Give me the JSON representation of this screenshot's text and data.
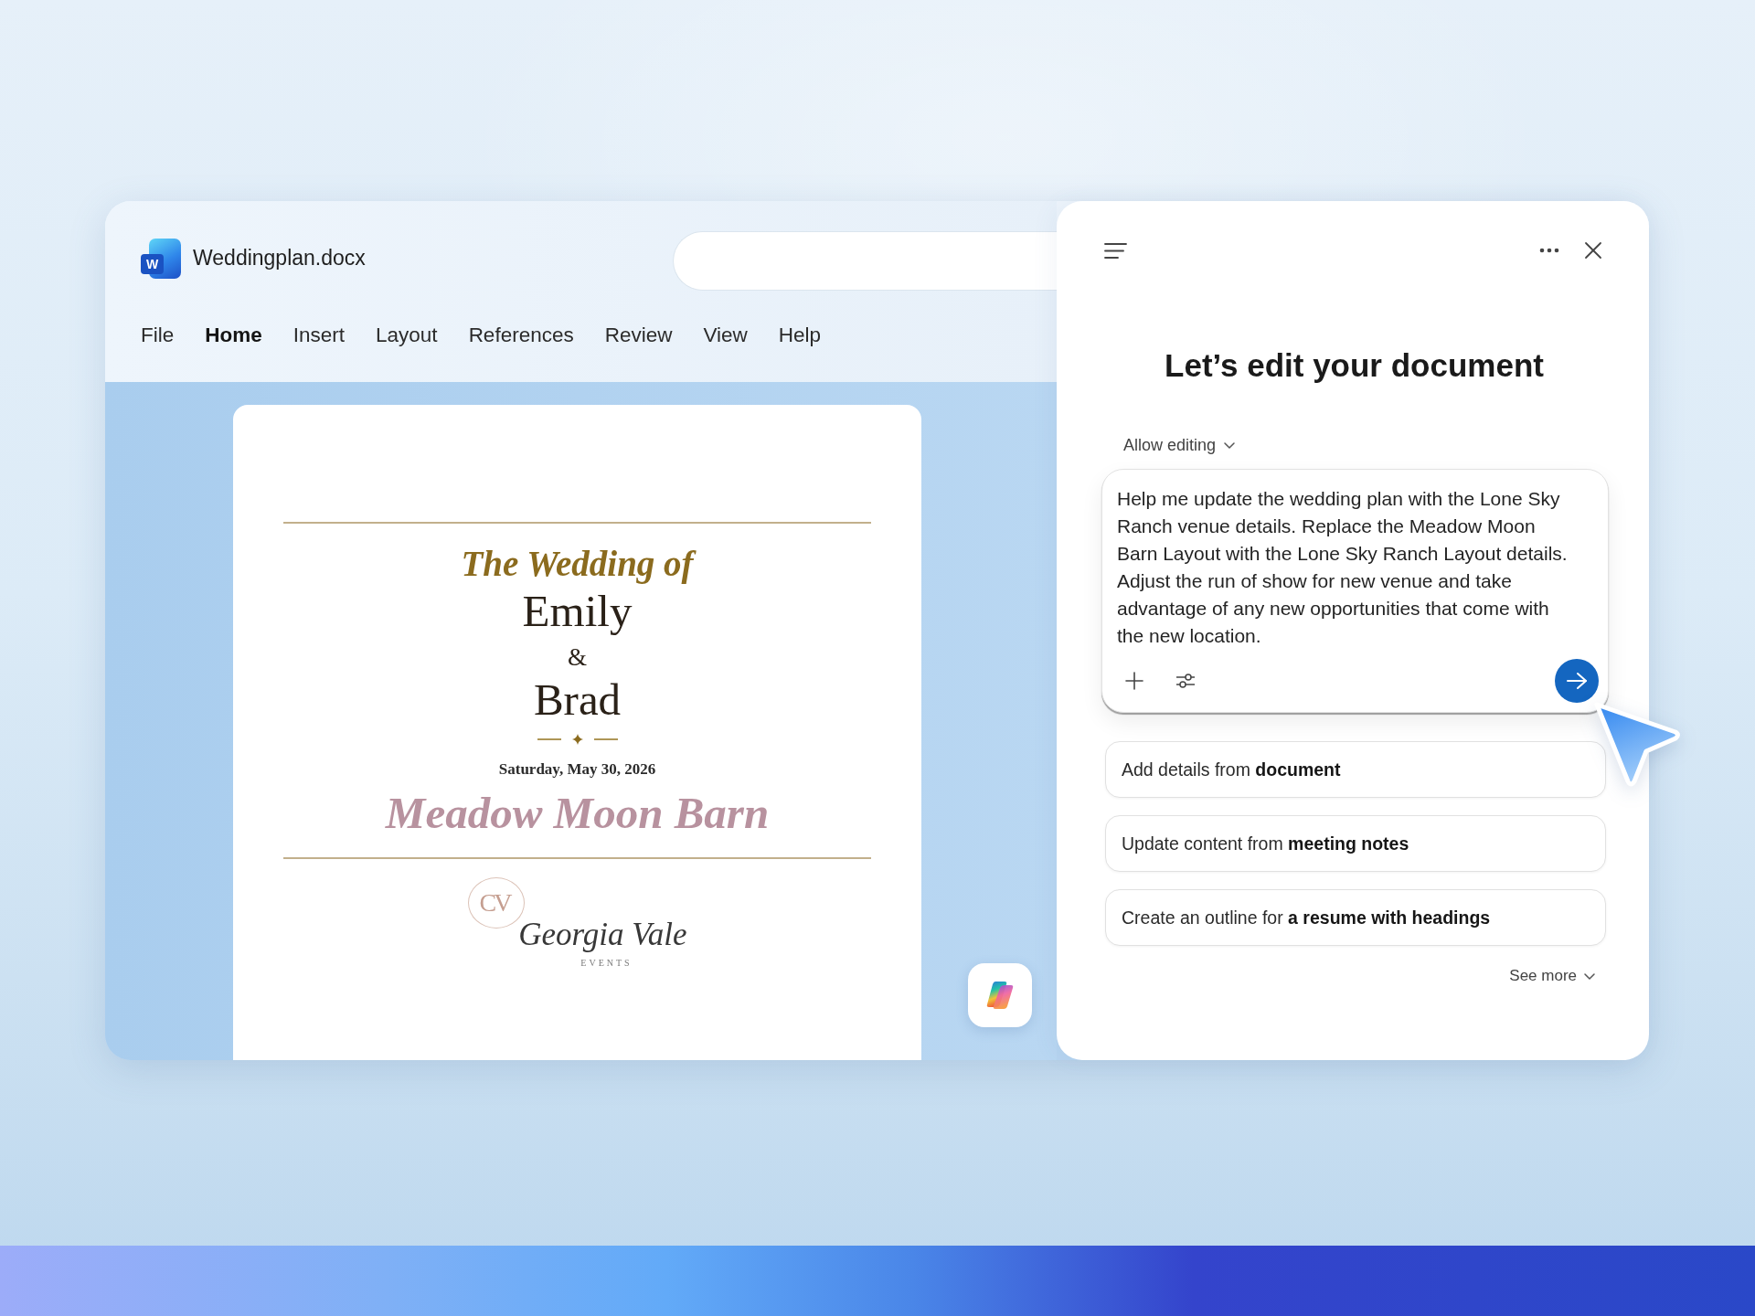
{
  "document_window": {
    "app_icon_letter": "W",
    "file_name": "Weddingplan.docx",
    "ribbon_tabs": [
      {
        "label": "File",
        "selected": false
      },
      {
        "label": "Home",
        "selected": true
      },
      {
        "label": "Insert",
        "selected": false
      },
      {
        "label": "Layout",
        "selected": false
      },
      {
        "label": "References",
        "selected": false
      },
      {
        "label": "Review",
        "selected": false
      },
      {
        "label": "View",
        "selected": false
      },
      {
        "label": "Help",
        "selected": false
      }
    ]
  },
  "document_page": {
    "heading": "The Wedding of",
    "partner_1": "Emily",
    "ampersand": "&",
    "partner_2": "Brad",
    "date": "Saturday, May 30, 2026",
    "venue": "Meadow Moon Barn",
    "logo": {
      "monogram": "CV",
      "name": "Georgia Vale",
      "tagline": "EVENTS"
    }
  },
  "assistant_panel": {
    "title": "Let’s edit your document",
    "mode_dropdown": "Allow editing",
    "prompt": {
      "value": "Help me update the wedding plan with the Lone Sky Ranch venue details. Replace the Meadow Moon Barn Layout with the Lone Sky Ranch Layout details. Adjust the run of show for new venue and take advantage of any new opportunities that come with the new location."
    },
    "suggestions": [
      "Add details from **document**",
      "Update content from **meeting notes**",
      "Create an outline for **a resume with headings**"
    ],
    "see_more": "See more"
  }
}
